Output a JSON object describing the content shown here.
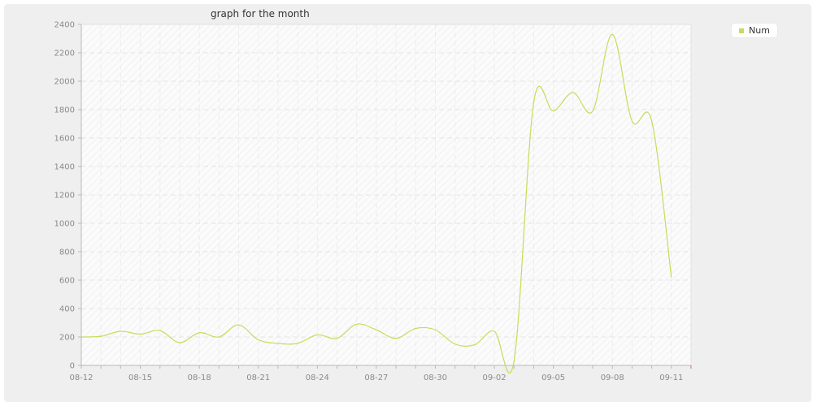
{
  "chart_data": {
    "type": "line",
    "title": "graph for the month",
    "xlabel": "",
    "ylabel": "",
    "ylim": [
      0,
      2400
    ],
    "yticks": [
      0,
      200,
      400,
      600,
      800,
      1000,
      1200,
      1400,
      1600,
      1800,
      2000,
      2200,
      2400
    ],
    "xtick_labels": [
      "08-12",
      "08-15",
      "08-18",
      "08-21",
      "08-24",
      "08-27",
      "08-30",
      "09-02",
      "09-05",
      "09-08",
      "09-11"
    ],
    "x": [
      "08-12",
      "08-13",
      "08-14",
      "08-15",
      "08-16",
      "08-17",
      "08-18",
      "08-19",
      "08-20",
      "08-21",
      "08-22",
      "08-23",
      "08-24",
      "08-25",
      "08-26",
      "08-27",
      "08-28",
      "08-29",
      "08-30",
      "08-31",
      "09-01",
      "09-02",
      "09-03",
      "09-04",
      "09-05",
      "09-06",
      "09-07",
      "09-08",
      "09-09",
      "09-10",
      "09-11",
      "09-12"
    ],
    "series": [
      {
        "name": "Num",
        "color": "#c7dc5a",
        "values": [
          200,
          205,
          240,
          220,
          245,
          160,
          230,
          200,
          285,
          180,
          155,
          155,
          215,
          190,
          290,
          250,
          190,
          260,
          250,
          150,
          145,
          240,
          30,
          1850,
          1790,
          1920,
          1790,
          2330,
          1720,
          1720,
          620
        ]
      }
    ],
    "grid": true,
    "legend_position": "top-right"
  }
}
